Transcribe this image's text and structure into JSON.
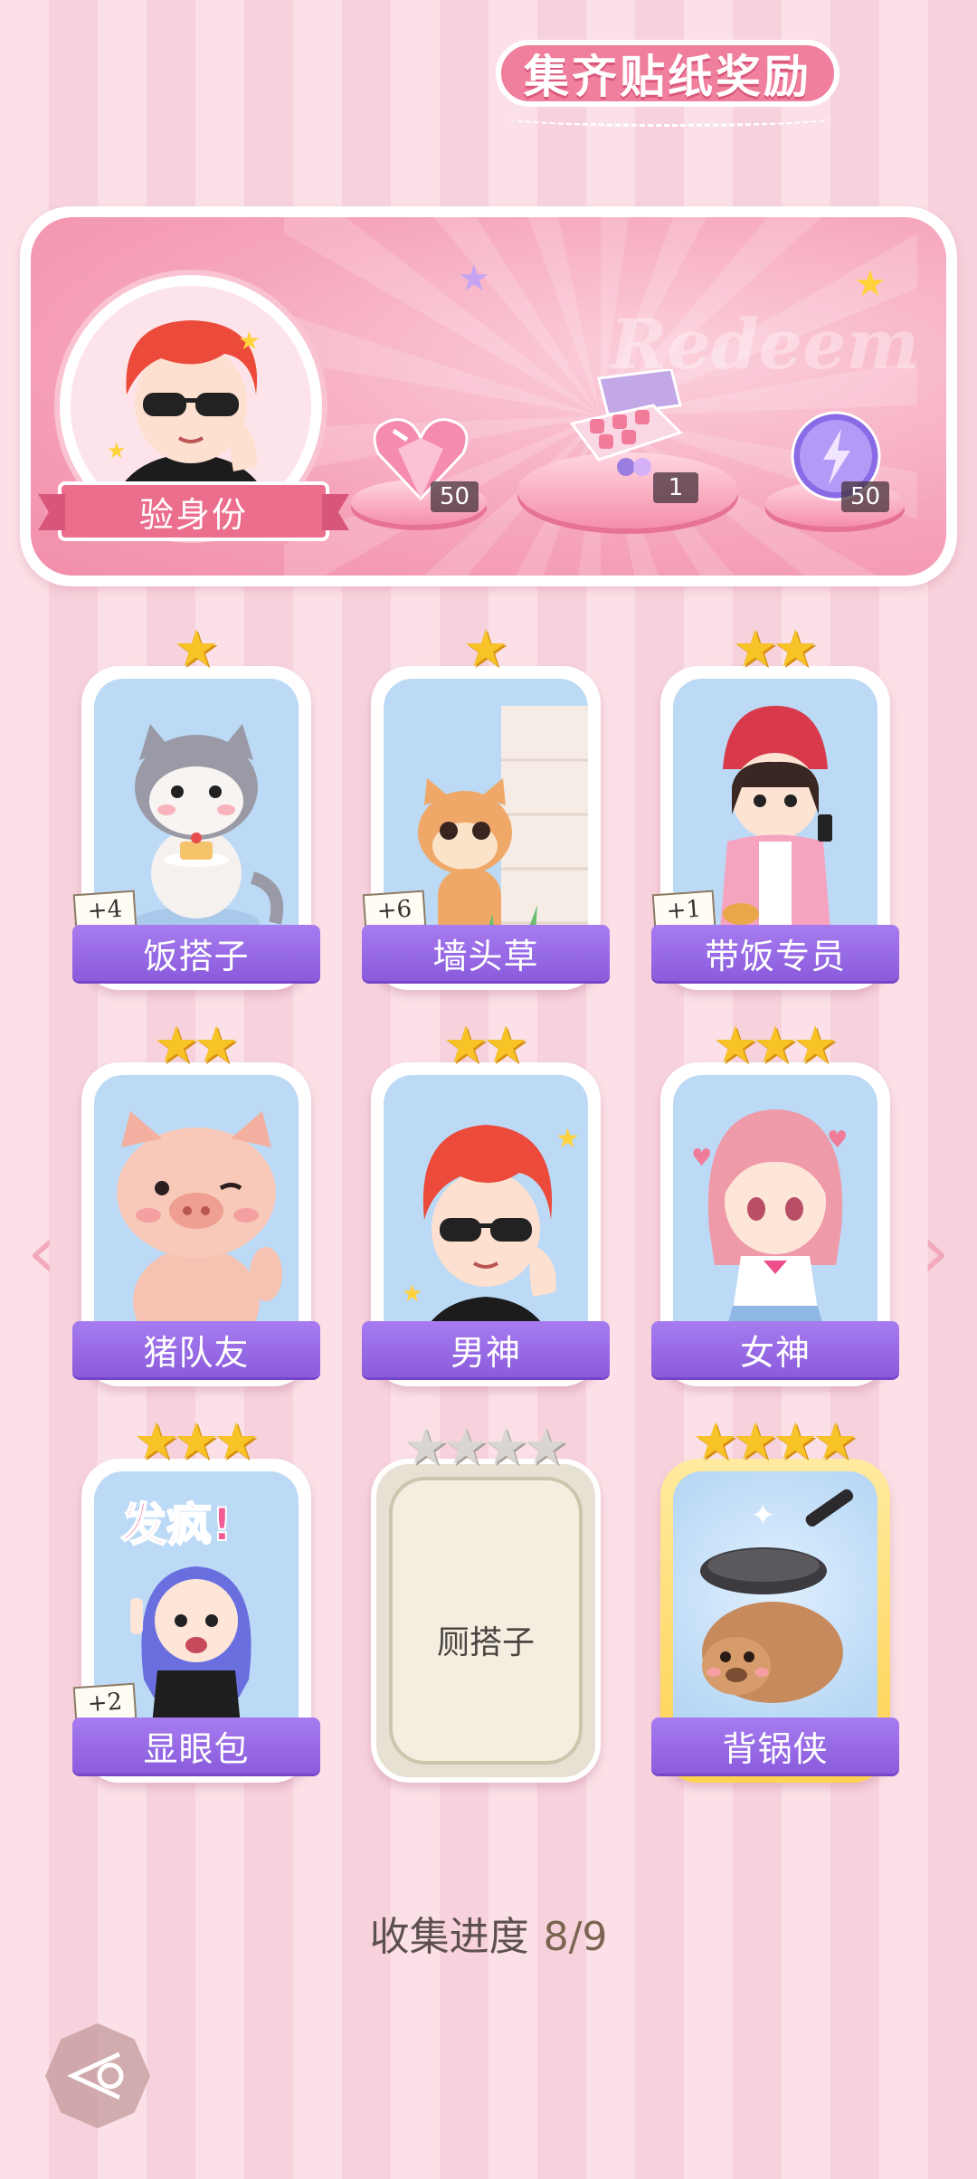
{
  "banner": {
    "title": "集齐贴纸奖励",
    "watermark": "Redeem",
    "verify_label": "验身份",
    "rewards": [
      {
        "icon": "pink-heart-gem-icon",
        "count": "50"
      },
      {
        "icon": "gift-box-icon",
        "count": "1"
      },
      {
        "icon": "purple-energy-orb-icon",
        "count": "50"
      }
    ]
  },
  "cards": [
    {
      "name": "饭搭子",
      "stars": 1,
      "dup": "+4",
      "art": "cat-with-cake"
    },
    {
      "name": "墙头草",
      "stars": 1,
      "dup": "+6",
      "art": "cat-behind-wall"
    },
    {
      "name": "带饭专员",
      "stars": 2,
      "dup": "+1",
      "art": "girl-with-lunch"
    },
    {
      "name": "猪队友",
      "stars": 2,
      "dup": "",
      "art": "pig"
    },
    {
      "name": "男神",
      "stars": 2,
      "dup": "",
      "art": "boy-with-sunglasses"
    },
    {
      "name": "女神",
      "stars": 3,
      "dup": "",
      "art": "girl-pink-hair"
    },
    {
      "name": "显眼包",
      "stars": 3,
      "dup": "+2",
      "art": "girl-blue-hair",
      "art_text": "发疯!"
    },
    {
      "name": "厕搭子",
      "stars": 4,
      "dup": "",
      "locked": true
    },
    {
      "name": "背锅侠",
      "stars": 4,
      "dup": "",
      "art": "capybara-with-pan",
      "gold": true
    }
  ],
  "progress": {
    "label": "收集进度",
    "value": "8/9"
  },
  "colors": {
    "accent": "#8a5bdc",
    "banner": "#f28ea9",
    "star": "#f7c326"
  }
}
